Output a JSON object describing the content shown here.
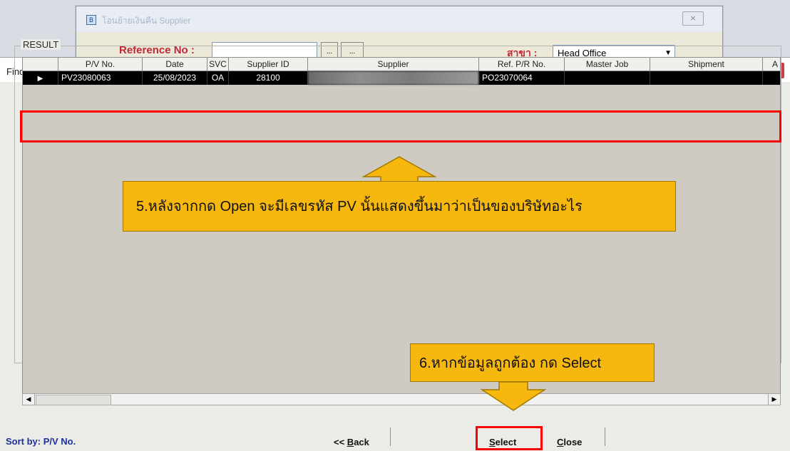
{
  "background_window": {
    "title": "โอนย้ายเงินคืน Supplier",
    "close_icon": "x-icon",
    "reference_label": "Reference No :",
    "reference_value": "",
    "browse_button_1": "...",
    "browse_button_2": "...",
    "branch_label": "สาขา :",
    "branch_value": "Head Office"
  },
  "dialog": {
    "title": "Find Payment Voucher",
    "close_label": "x",
    "result_label": "RESULT"
  },
  "grid": {
    "columns": [
      "",
      "P/V No.",
      "Date",
      "SVC",
      "Supplier ID",
      "Supplier",
      "Ref. P/R No.",
      "Master Job",
      "Shipment",
      "A"
    ],
    "rows": [
      {
        "pv_no": "PV23080063",
        "date": "25/08/2023",
        "svc": "OA",
        "supplier_id": "28100",
        "supplier": "",
        "ref_pr_no": "PO23070064",
        "master_job": "",
        "shipment": ""
      }
    ]
  },
  "footer": {
    "sort_label": "Sort by:  P/V No.",
    "back_prefix": "<< ",
    "back_accel": "B",
    "back_rest": "ack",
    "select_accel": "S",
    "select_rest": "elect",
    "close_accel": "C",
    "close_rest": "lose"
  },
  "annotations": {
    "step5": "5.หลังจากกด Open จะมีเลขรหัส PV นั้นแสดงขึ้นมาว่าเป็นของบริษัทอะไร",
    "step6": "6.หากข้อมูลถูกต้อง กด Select"
  },
  "colors": {
    "highlight": "#ff0000",
    "callout": "#f6b70f",
    "row_selected": "#000000",
    "sort_text": "#1d2f9c"
  }
}
